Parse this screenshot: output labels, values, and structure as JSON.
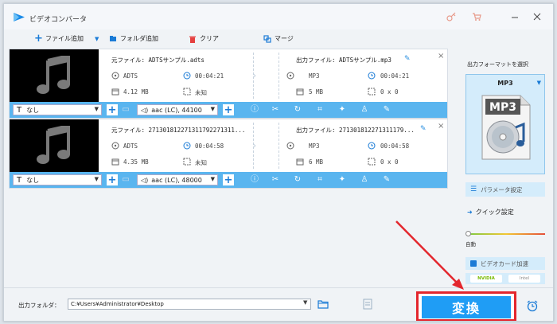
{
  "app": {
    "title": "ビデオコンバータ"
  },
  "toolbar": {
    "add_file": "ファイル追加",
    "add_folder": "フォルダ追加",
    "clear": "クリア",
    "merge": "マージ"
  },
  "files": [
    {
      "source_name": "元ファイル: ADTSサンプル.adts",
      "src_format": "ADTS",
      "src_duration": "00:04:21",
      "src_size": "4.12 MB",
      "src_resolution": "未知",
      "output_name": "出力ファイル: ADTSサンプル.mp3",
      "out_format": "MP3",
      "out_duration": "00:04:21",
      "out_size": "5 MB",
      "out_resolution": "0 x 0",
      "subtitle": "なし",
      "audio": "aac (LC), 44100"
    },
    {
      "source_name": "元ファイル: 271301812271311792271311...",
      "src_format": "ADTS",
      "src_duration": "00:04:58",
      "src_size": "4.35 MB",
      "src_resolution": "未知",
      "output_name": "出力ファイル: 271301812271311179...",
      "out_format": "MP3",
      "out_duration": "00:04:58",
      "out_size": "6 MB",
      "out_resolution": "0 x 0",
      "subtitle": "なし",
      "audio": "aac (LC), 48000"
    }
  ],
  "right_panel": {
    "title": "出力フォーマットを選択",
    "format": "MP3",
    "format_icon_text": "MP3",
    "param_settings": "パラメータ設定",
    "quick_settings": "クイック設定",
    "slider_label": "自動",
    "slider_value": 0,
    "gpu_accel": "ビデオカード加速",
    "gpu_nvidia": "NVIDIA",
    "gpu_intel": "Intel"
  },
  "bottom": {
    "output_folder_label": "出力フォルダ：",
    "output_path": "C:¥Users¥Administrator¥Desktop",
    "convert": "変換"
  },
  "colors": {
    "accent": "#1f9df5",
    "control_bar": "#5ab5ef",
    "highlight": "#e3262d"
  }
}
